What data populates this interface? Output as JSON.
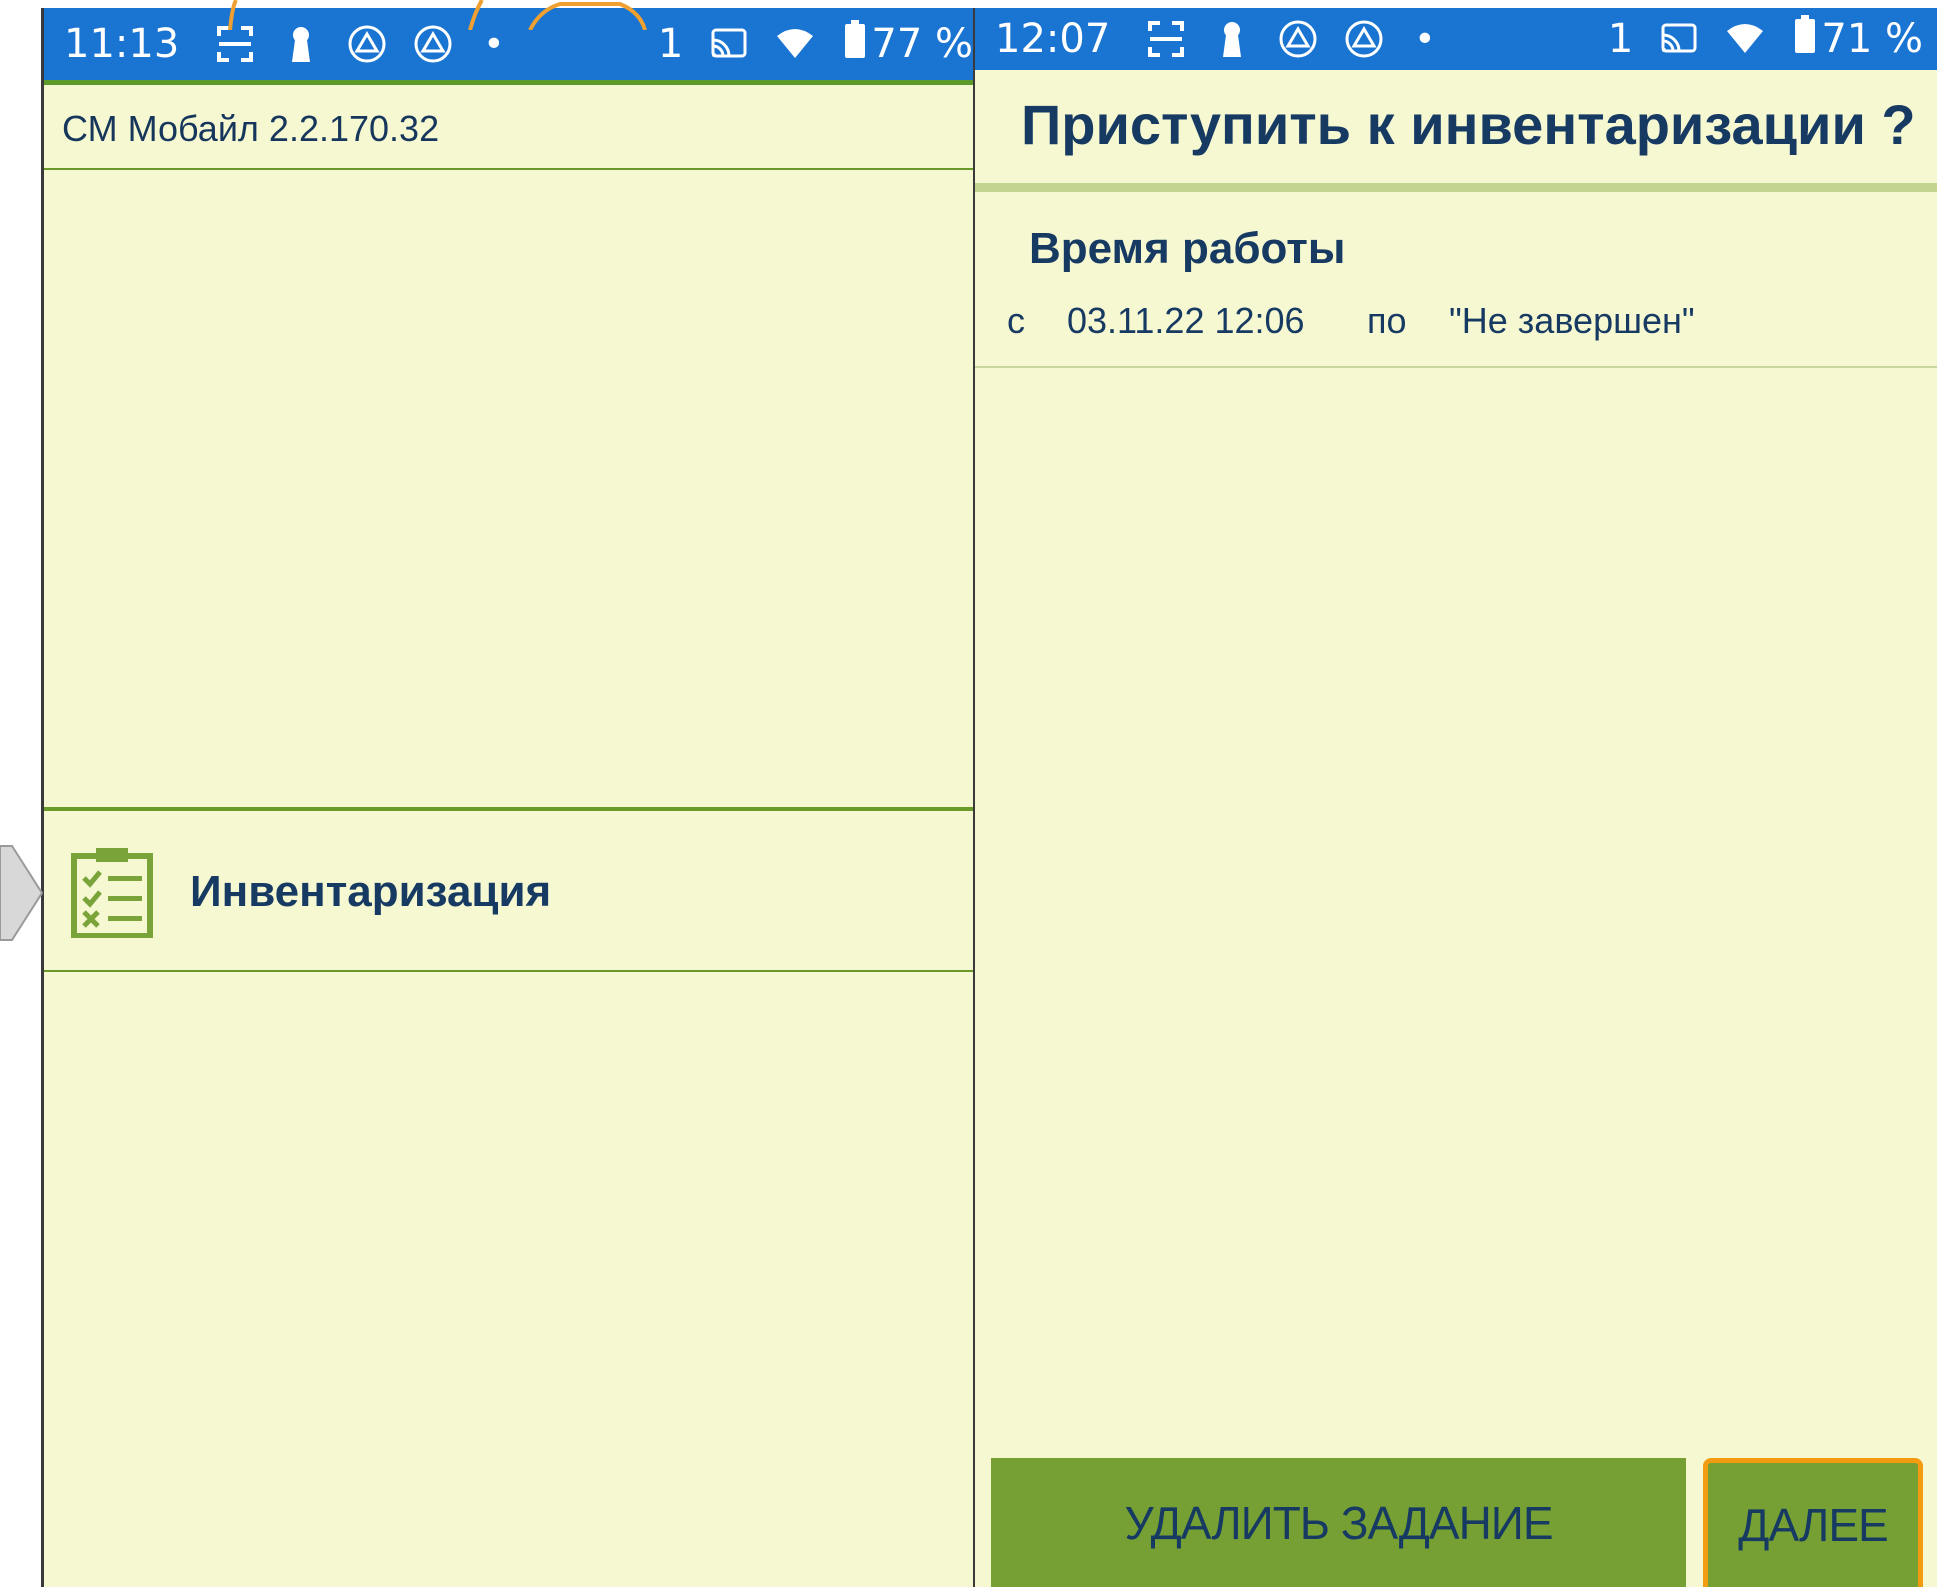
{
  "left_screen": {
    "status_bar": {
      "time": "11:13",
      "notification_count": "1",
      "battery": "77 %"
    },
    "app_version": "СМ Мобайл 2.2.170.32",
    "menu": {
      "items": [
        {
          "label": "Инвентаризация",
          "icon": "clipboard-checklist-icon"
        }
      ]
    }
  },
  "right_screen": {
    "status_bar": {
      "time": "12:07",
      "notification_count": "1",
      "battery": "71 %"
    },
    "title": "Приступить к инвентаризации ?",
    "section": {
      "heading": "Время работы",
      "from_label": "с",
      "start": "03.11.22 12:06",
      "to_label": "по",
      "end": "\"Не завершен\""
    },
    "buttons": {
      "delete_label": "УДАЛИТЬ ЗАДАНИЕ",
      "next_label": "ДАЛЕЕ"
    }
  },
  "colors": {
    "status_bar": "#1a74d2",
    "background": "#f6f8d2",
    "text_primary": "#173a63",
    "accent_green": "#77a034",
    "focus_orange": "#f39c12"
  }
}
